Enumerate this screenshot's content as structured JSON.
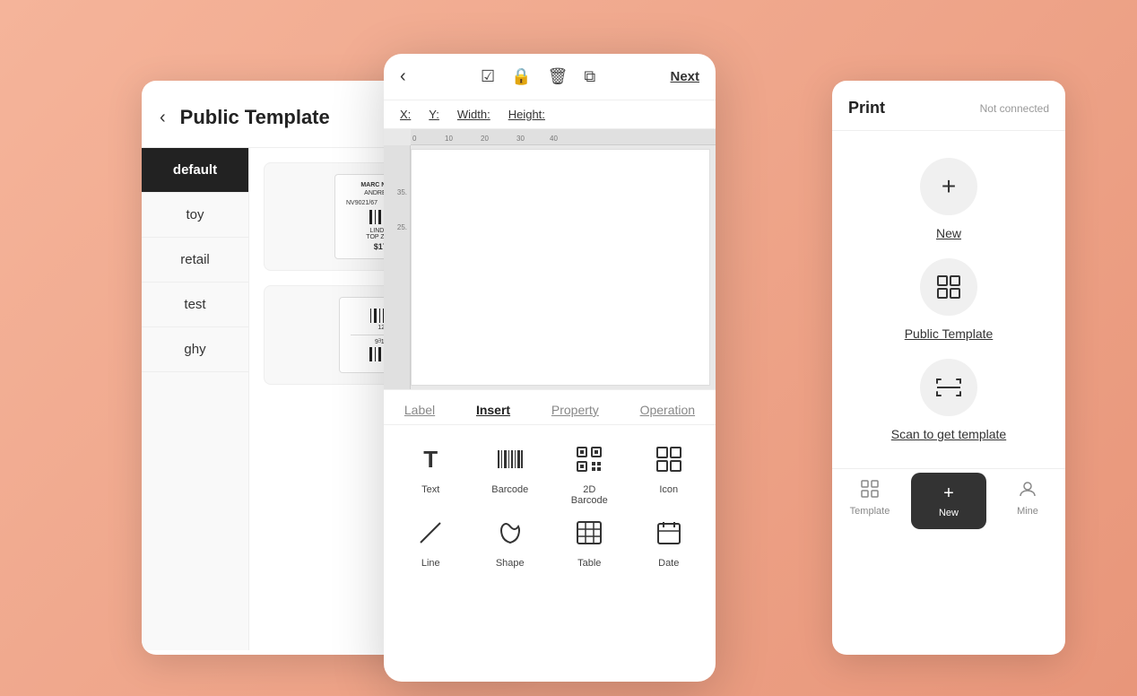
{
  "background": "#f0a080",
  "leftPanel": {
    "title": "Public Template",
    "backLabel": "‹",
    "sidebarItems": [
      {
        "id": "default",
        "label": "default",
        "active": true
      },
      {
        "id": "toy",
        "label": "toy"
      },
      {
        "id": "retail",
        "label": "retail"
      },
      {
        "id": "test",
        "label": "test"
      },
      {
        "id": "ghy",
        "label": "ghy"
      }
    ]
  },
  "centerPanel": {
    "backLabel": "‹",
    "nextLabel": "Next",
    "toolIcons": [
      "✓",
      "🔒",
      "🗑",
      "⧉"
    ],
    "coords": {
      "x": "X:",
      "y": "Y:",
      "width": "Width:",
      "height": "Height:"
    },
    "xValue": "",
    "yValue": "",
    "widthValue": "",
    "heightValue": "",
    "rulerMarks": [
      "0",
      "10",
      "20",
      "30",
      "40"
    ],
    "sideMarks": [
      "",
      "35.",
      "25."
    ],
    "tabs": [
      {
        "id": "label",
        "label": "Label"
      },
      {
        "id": "insert",
        "label": "Insert",
        "active": true
      },
      {
        "id": "property",
        "label": "Property"
      },
      {
        "id": "operation",
        "label": "Operation"
      }
    ],
    "insertItems": [
      {
        "id": "text",
        "label": "Text",
        "icon": "T"
      },
      {
        "id": "barcode",
        "label": "Barcode",
        "icon": "barcode"
      },
      {
        "id": "2d-barcode",
        "label": "2D\nBarcode",
        "icon": "qr"
      },
      {
        "id": "icon",
        "label": "Icon",
        "icon": "icon"
      },
      {
        "id": "line",
        "label": "Line",
        "icon": "line"
      },
      {
        "id": "shape",
        "label": "Shape",
        "icon": "shape"
      },
      {
        "id": "table",
        "label": "Table",
        "icon": "table"
      },
      {
        "id": "date",
        "label": "Date",
        "icon": "date"
      }
    ]
  },
  "rightPanel": {
    "title": "Print",
    "status": "Not connected",
    "options": [
      {
        "id": "new",
        "label": "New",
        "icon": "+"
      },
      {
        "id": "public-template",
        "label": "Public Template",
        "icon": "⊞"
      },
      {
        "id": "scan",
        "label": "Scan to get template",
        "icon": "⇔"
      }
    ],
    "bottomTabs": [
      {
        "id": "template",
        "label": "Template",
        "icon": "⊞"
      },
      {
        "id": "new",
        "label": "New",
        "icon": "+",
        "active": true
      },
      {
        "id": "mine",
        "label": "Mine",
        "icon": "👤"
      }
    ]
  }
}
